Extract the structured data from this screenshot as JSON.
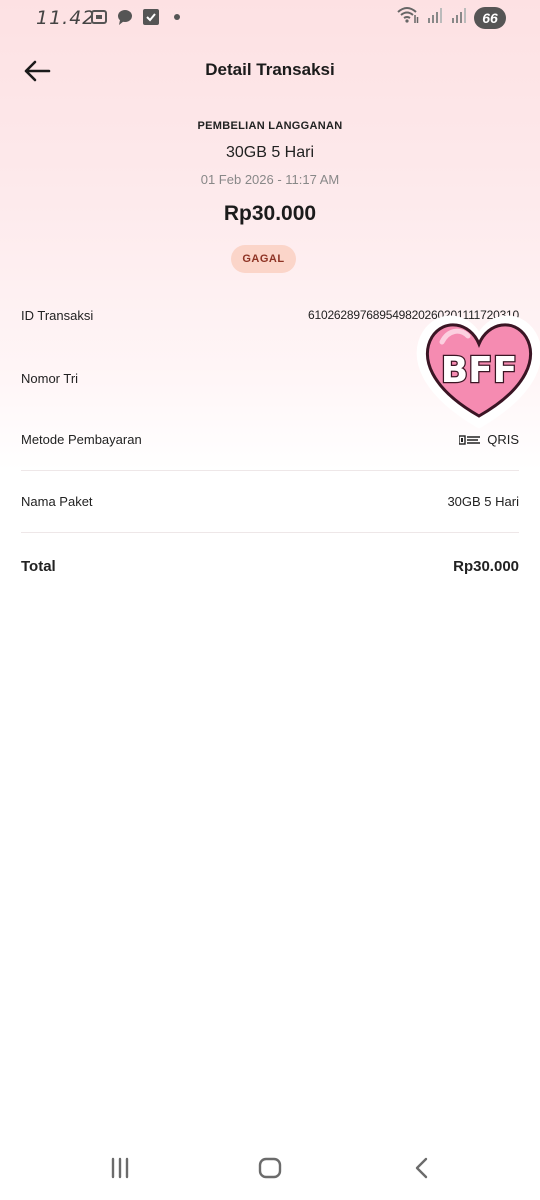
{
  "status_bar": {
    "time": "11.42",
    "battery": "66"
  },
  "header": {
    "title": "Detail Transaksi"
  },
  "summary": {
    "category": "PEMBELIAN LANGGANAN",
    "product": "30GB 5 Hari",
    "datetime": "01 Feb 2026 - 11:17 AM",
    "amount": "Rp30.000",
    "status": "GAGAL"
  },
  "details": {
    "id_label": "ID Transaksi",
    "id_value": "610262897689549820260201111720310",
    "nomor_label": "Nomor Tri",
    "method_label": "Metode Pembayaran",
    "method_value": "QRIS",
    "paket_label": "Nama Paket",
    "paket_value": "30GB 5 Hari",
    "total_label": "Total",
    "total_value": "Rp30.000"
  },
  "sticker": {
    "text": "BFF"
  },
  "colors": {
    "badge_bg": "#fbd5c9",
    "badge_text": "#8e3324",
    "sticker_pink": "#f58bb1"
  }
}
